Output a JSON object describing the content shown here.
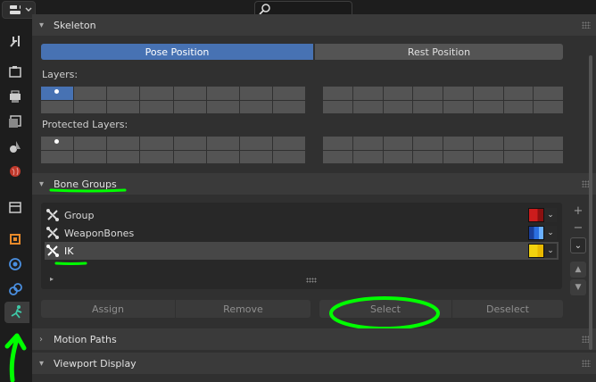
{
  "skeleton": {
    "title": "Skeleton",
    "pose_position": "Pose Position",
    "rest_position": "Rest Position",
    "layers_label": "Layers:",
    "protected_label": "Protected Layers:"
  },
  "bone_groups": {
    "title": "Bone Groups",
    "items": [
      {
        "label": "Group",
        "color_top": "#cc1c1c",
        "color_bottom": "#8a1010"
      },
      {
        "label": "WeaponBones",
        "color_top": "#2b6fe0",
        "color_bottom": "#1a3f9a"
      },
      {
        "label": "IK",
        "color_top": "#f2d20e",
        "color_bottom": "#e8b800"
      }
    ],
    "selected": "IK",
    "assign": "Assign",
    "remove": "Remove",
    "select": "Select",
    "deselect": "Deselect"
  },
  "motion_paths": {
    "title": "Motion Paths"
  },
  "viewport_display": {
    "title": "Viewport Display"
  },
  "colors": {
    "accent": "#4772b3",
    "annotation": "#00ff00",
    "panel": "#303030",
    "header": "#3a3a3a"
  },
  "tab_icons": [
    "tool-icon",
    "render-icon",
    "output-icon",
    "view-layer-icon",
    "scene-icon",
    "world-icon",
    "collection-icon",
    "object-icon",
    "modifiers-icon",
    "physics-icon",
    "armature-data-icon"
  ]
}
